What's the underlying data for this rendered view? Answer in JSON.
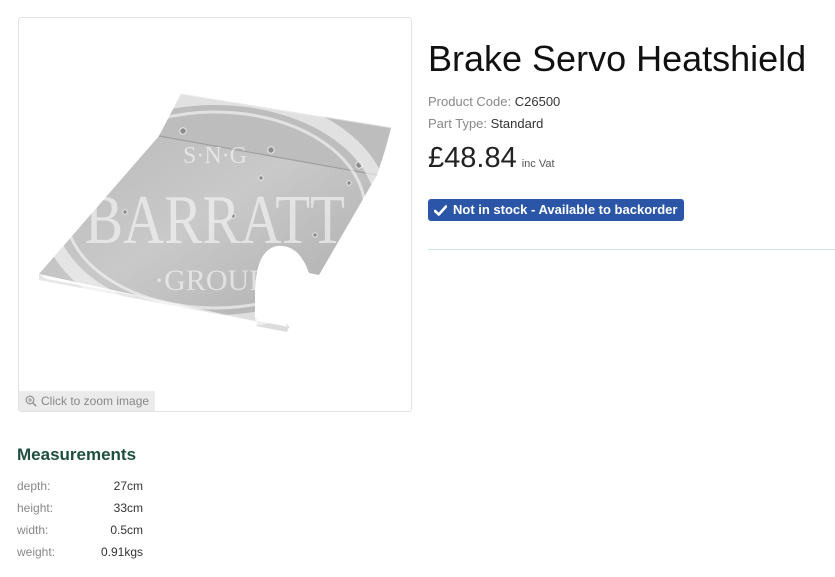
{
  "product": {
    "title": "Brake Servo Heatshield",
    "code_label": "Product Code:",
    "code": "C26500",
    "type_label": "Part Type:",
    "type": "Standard",
    "price": "£48.84",
    "vat_label": "inc Vat",
    "stock_status": "Not in stock - Available to backorder"
  },
  "image": {
    "zoom_hint": "Click to zoom image",
    "watermark": {
      "top": "S·N·G",
      "main": "BARRATT",
      "bottom": "·GROUP·"
    }
  },
  "measurements": {
    "title": "Measurements",
    "rows": [
      {
        "label": "depth:",
        "value": "27cm"
      },
      {
        "label": "height:",
        "value": "33cm"
      },
      {
        "label": "width:",
        "value": "0.5cm"
      },
      {
        "label": "weight:",
        "value": "0.91kgs"
      }
    ]
  },
  "colors": {
    "badge": "#2b56a8",
    "heading": "#1f4f41",
    "divider": "#cfe3dd"
  },
  "icons": {
    "zoom": "magnifier-plus-icon",
    "stock": "check-icon"
  }
}
